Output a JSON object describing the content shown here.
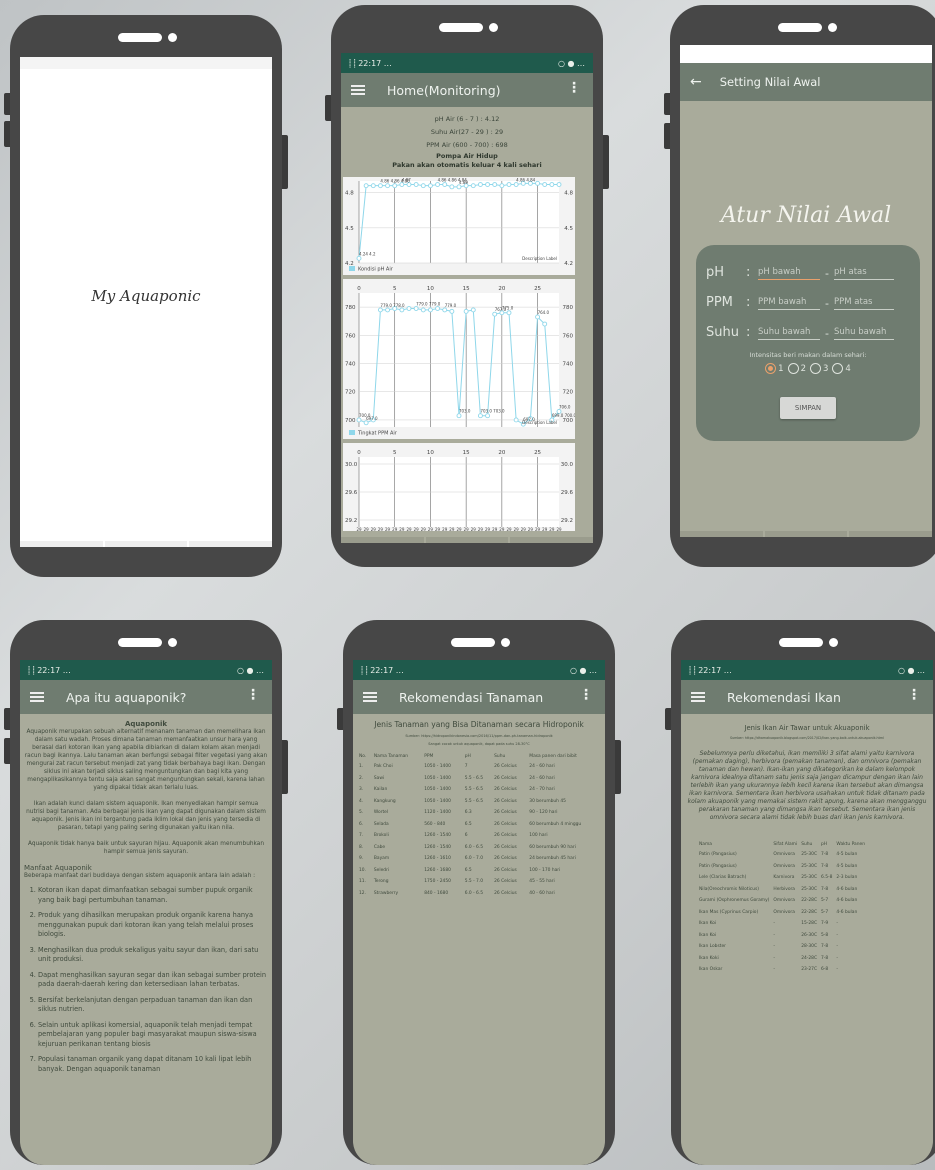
{
  "status_bar": {
    "left": "⸽ ⸽ 22:17 …",
    "right": "○ ● …"
  },
  "splash": {
    "logo_text": "My Aquaponic"
  },
  "home": {
    "title": "Home(Monitoring)",
    "readings": [
      {
        "label": "pH Air  (6  - 7  ) :",
        "value": "4.12"
      },
      {
        "label": "Suhu Air(27  - 29 ) :",
        "value": "29"
      },
      {
        "label": "PPM Air (600 - 700) :",
        "value": "698"
      }
    ],
    "pump_status": "Pompa Air Hidup",
    "feed_status": "Pakan akan otomatis keluar 4 kali sehari"
  },
  "chart_data": [
    {
      "type": "line",
      "title": "",
      "legend": "Kondisi pH Air",
      "description_label": "Description Label",
      "ylim": [
        4.2,
        4.9
      ],
      "y_ticks": [
        "4.2",
        "4.5",
        "4.8"
      ],
      "grid": true,
      "legend_position": "bottom-left",
      "x": [
        0,
        1,
        2,
        3,
        4,
        5,
        6,
        7,
        8,
        9,
        10,
        11,
        12,
        13,
        14,
        15,
        16,
        17,
        18,
        19,
        20,
        21,
        22,
        23,
        24,
        25,
        26,
        27,
        28
      ],
      "values": [
        4.24,
        4.86,
        4.86,
        4.86,
        4.86,
        4.86,
        4.87,
        4.87,
        4.87,
        4.86,
        4.86,
        4.87,
        4.87,
        4.85,
        4.85,
        4.86,
        4.86,
        4.87,
        4.87,
        4.87,
        4.86,
        4.87,
        4.87,
        4.88,
        4.88,
        4.88,
        4.87,
        4.87,
        4.87
      ],
      "point_labels": [
        {
          "x": 0,
          "text": "4.24 4.2"
        },
        {
          "x": 3,
          "text": "4.86 4.86 4.86"
        },
        {
          "x": 6,
          "text": "4.87"
        },
        {
          "x": 11,
          "text": "4.86 4.86 4.84"
        },
        {
          "x": 14,
          "text": "4.89"
        },
        {
          "x": 22,
          "text": "4.86 4.84"
        }
      ]
    },
    {
      "type": "line",
      "title": "",
      "legend": "Tingkat PPM Air",
      "description_label": "Description Label",
      "ylim": [
        695,
        790
      ],
      "y_ticks": [
        "700",
        "720",
        "740",
        "760",
        "780"
      ],
      "x_ticks": [
        "0",
        "5",
        "10",
        "15",
        "20",
        "25"
      ],
      "grid": true,
      "legend_position": "bottom-left",
      "x": [
        0,
        1,
        2,
        3,
        4,
        5,
        6,
        7,
        8,
        9,
        10,
        11,
        12,
        13,
        14,
        15,
        16,
        17,
        18,
        19,
        20,
        21,
        22,
        23,
        24,
        25,
        26,
        27,
        28
      ],
      "values": [
        700,
        698,
        700,
        778,
        778,
        779,
        778,
        779,
        779,
        778,
        778,
        779,
        778,
        777,
        703,
        777,
        778,
        703,
        703,
        775,
        776,
        776,
        700,
        697,
        701,
        773,
        768,
        700,
        706
      ],
      "point_labels": [
        {
          "x": 0,
          "text": "700.0"
        },
        {
          "x": 1,
          "text": "697.0"
        },
        {
          "x": 3,
          "text": "779.0 778.0"
        },
        {
          "x": 8,
          "text": "779.0 779.0"
        },
        {
          "x": 12,
          "text": "779.0"
        },
        {
          "x": 14,
          "text": "703.0"
        },
        {
          "x": 17,
          "text": "703.0 703.0"
        },
        {
          "x": 19,
          "text": "767.0"
        },
        {
          "x": 20,
          "text": "775.0"
        },
        {
          "x": 23,
          "text": "697.0"
        },
        {
          "x": 25,
          "text": "764.0"
        },
        {
          "x": 27,
          "text": "699.0 700.0"
        },
        {
          "x": 28,
          "text": "706.0"
        }
      ]
    },
    {
      "type": "line",
      "title": "",
      "legend": "",
      "ylim": [
        29.1,
        30.1
      ],
      "y_ticks": [
        "29.2",
        "29.6",
        "30.0"
      ],
      "x_ticks": [
        "0",
        "5",
        "10",
        "15",
        "20",
        "25"
      ],
      "grid": true,
      "x": [
        0,
        1,
        2,
        3,
        4,
        5,
        6,
        7,
        8,
        9,
        10,
        11,
        12,
        13,
        14,
        15,
        16,
        17,
        18,
        19,
        20,
        21,
        22,
        23,
        24,
        25,
        26,
        27,
        28
      ],
      "values": [
        29,
        29,
        29,
        29,
        29,
        29,
        29,
        29,
        29,
        29,
        29,
        29,
        29,
        29,
        29,
        29,
        29,
        29,
        29,
        29,
        29,
        29,
        29,
        29,
        29,
        29,
        29,
        29,
        29
      ],
      "point_label_text": "29"
    }
  ],
  "setting": {
    "title": "Setting Nilai Awal",
    "heading": "Atur Nilai Awal",
    "rows": [
      {
        "label": "pH",
        "colon": ":",
        "low": "pH bawah",
        "dash": "-",
        "high": "pH atas"
      },
      {
        "label": "PPM",
        "colon": ":",
        "low": "PPM bawah",
        "dash": "-",
        "high": "PPM atas"
      },
      {
        "label": "Suhu",
        "colon": ":",
        "low": "Suhu bawah",
        "dash": "-",
        "high": "Suhu bawah"
      }
    ],
    "feed_question": "Intensitas beri makan dalam sehari:",
    "options": [
      "1",
      "2",
      "3",
      "4"
    ],
    "selected_option": "1",
    "save_button": "SIMPAN"
  },
  "about": {
    "title": "Apa itu aquaponik?",
    "heading": "Aquaponik",
    "p1": "Aquaponik merupakan sebuah alternatif menanam tanaman dan memelihara ikan dalam satu wadah. Proses dimana tanaman memanfaatkan unsur hara yang berasal dari kotoran ikan yang apabila dibiarkan di dalam kolam akan menjadi racun bagi ikannya. Lalu tanaman akan berfungsi sebagai filter vegetasi yang akan mengurai zat racun tersebut menjadi zat yang tidak berbahaya bagi ikan. Dengan siklus ini akan terjadi siklus saling menguntungkan dan bagi kita yang mengaplikasikannya tentu saja akan sangat menguntungkan sekali, karena lahan yang dipakai tidak akan terlalu luas.",
    "p2": "Ikan adalah kunci dalam sistem aquaponik. Ikan menyediakan hampir semua nutrisi bagi tanaman. Ada berbagai jenis ikan yang dapat digunakan dalam sistem aquaponik. Jenis ikan ini tergantung pada iklim lokal dan jenis yang tersedia di pasaran, tetapi yang paling sering digunakan yaitu ikan nila.",
    "p3": "Aquaponik tidak hanya baik untuk sayuran hijau. Aquaponik akan menumbuhkan hampir semua jenis sayuran.",
    "benefit_title": "Manfaat Aquaponik",
    "benefit_intro": "Beberapa manfaat dari budidaya dengan sistem aquaponik antara lain adalah :",
    "benefits": [
      "Kotoran ikan dapat dimanfaatkan sebagai sumber pupuk organik yang baik bagi pertumbuhan tanaman.",
      "Produk yang dihasilkan merupakan produk organik karena hanya menggunakan pupuk dari kotoran ikan yang telah melalui proses biologis.",
      "Menghasilkan dua produk sekaligus yaitu sayur dan ikan, dari satu unit produksi.",
      "Dapat menghasilkan sayuran segar dan ikan sebagai sumber protein pada daerah-daerah kering dan ketersediaan lahan terbatas.",
      "Bersifat berkelanjutan dengan perpaduan tanaman dan ikan dan siklus nutrien.",
      "Selain untuk aplikasi komersial, aquaponik telah menjadi tempat pembelajaran yang populer bagi masyarakat maupun siswa-siswa kejuruan perikanan tentang biosis",
      "Populasi tanaman organik yang dapat ditanam 10 kali lipat lebih banyak. Dengan aquaponik tanaman"
    ]
  },
  "plants": {
    "title": "Rekomendasi Tanaman",
    "heading": "Jenis Tanaman yang Bisa Ditanaman secara Hidroponik",
    "source1": "Sumber: https://hidroponikindonesia.com/2016/11/ppm-dan-ph-tanaman-hidroponik",
    "source2": "Sangat cocok untuk aquaponik, dapat pada suhu 28-30°C",
    "columns": [
      "No.",
      "Nama Tanaman",
      "PPM",
      "pH",
      "Suhu",
      "Masa panen dari bibit"
    ],
    "rows": [
      [
        "1.",
        "Pak Choi",
        "1050 - 1400",
        "7",
        "26 Celcius",
        "24 - 60 hari"
      ],
      [
        "2.",
        "Sawi",
        "1050 - 1400",
        "5.5 - 6.5",
        "26 Celcius",
        "24 - 60 hari"
      ],
      [
        "3.",
        "Kailan",
        "1050 - 1400",
        "5.5 - 6.5",
        "26 Celcius",
        "24 - 70 hari"
      ],
      [
        "4.",
        "Kangkung",
        "1050 - 1400",
        "5.5 - 6.5",
        "26 Celcius",
        "30 berumbuh 45"
      ],
      [
        "5.",
        "Wortel",
        "1120 - 1400",
        "6.3",
        "26 Celcius",
        "90 - 120 hari"
      ],
      [
        "6.",
        "Selada",
        "560 - 840",
        "6.5",
        "26 Celcius",
        "60 berumbuh 4 minggu"
      ],
      [
        "7.",
        "Brokoli",
        "1260 - 1540",
        "6",
        "26 Celcius",
        "100 hari"
      ],
      [
        "8.",
        "Cabe",
        "1260 - 1540",
        "6.0 - 6.5",
        "26 Celcius",
        "60 berumbuh 90 hari"
      ],
      [
        "9.",
        "Bayam",
        "1260 - 1610",
        "6.0 - 7.0",
        "26 Celcius",
        "24 berumbuh 45 hari"
      ],
      [
        "10.",
        "Seledri",
        "1260 - 1680",
        "6.5",
        "26 Celcius",
        "100 - 170 hari"
      ],
      [
        "11.",
        "Terong",
        "1750 - 2450",
        "5.5 - 7.0",
        "26 Celcius",
        "45 - 55 hari"
      ],
      [
        "12.",
        "Strawberry",
        "840 - 1680",
        "6.0 - 6.5",
        "26 Celcius",
        "40 - 60 hari"
      ]
    ]
  },
  "fish": {
    "title": "Rekomendasi Ikan",
    "heading": "Jenis Ikan Air Tawar untuk Akuaponik",
    "source": "Sumber: https://dhamakuaponik.blogspot.com/2017/02/ikan-yang-baik-untuk-akuaponik.html",
    "paragraph": "Sebelumnya perlu diketahui, ikan memiliki 3 sifat alami yaitu karnivora (pemakan daging), herbivora (pemakan tanaman), dan omnivora (pemakan tanaman dan hewan). Ikan-ikan yang dikategorikan ke dalam kelompok karnivora idealnya ditanam satu jenis saja jangan dicampur dengan ikan lain terlebih ikan yang ukurannya lebih kecil karena ikan tersebut akan dimangsa ikan karnivora. Sementara ikan herbivora usahakan untuk tidak ditanam pada kolam akuaponik yang memakai sistem rakit apung, karena akan mengganggu perakaran tanaman yang dimangsa ikan tersebut. Sementara ikan jenis omnivora secara alami tidak lebih buas dari ikan jenis karnivora.",
    "columns": [
      "Nama",
      "Sifat Alami",
      "Suhu",
      "pH",
      "Waktu Panen"
    ],
    "rows": [
      [
        "Patin (Pangasius)",
        "Omnivora",
        "25-30C",
        "7-8",
        "4-5 bulan"
      ],
      [
        "Patin (Pangasius)",
        "Omnivora",
        "25-30C",
        "7-8",
        "4-5 bulan"
      ],
      [
        "Lele (Clarias Batrach)",
        "Karnivora",
        "25-30C",
        "6.5-8",
        "2-3 bulan"
      ],
      [
        "Nila(Oreochromis Niloticus)",
        "Herbivora",
        "25-30C",
        "7-8",
        "4-6 bulan"
      ],
      [
        "Gurami (Osphronemus Goramy)",
        "Omnivora",
        "22-28C",
        "5-7",
        "4-6 bulan"
      ],
      [
        "Ikan Mas (Cyprinus Carpio)",
        "Omnivora",
        "22-28C",
        "5-7",
        "4-6 bulan"
      ],
      [
        "Ikan Koi",
        "-",
        "15-28C",
        "7-9",
        "-"
      ],
      [
        "Ikan Koi",
        "-",
        "26-30C",
        "5-8",
        "-"
      ],
      [
        "Ikan Lobster",
        "-",
        "28-30C",
        "7-8",
        "-"
      ],
      [
        "Ikan Koki",
        "-",
        "24-28C",
        "7-8",
        "-"
      ],
      [
        "Ikan Oskar",
        "-",
        "23-27C",
        "6-8",
        "-"
      ]
    ]
  }
}
